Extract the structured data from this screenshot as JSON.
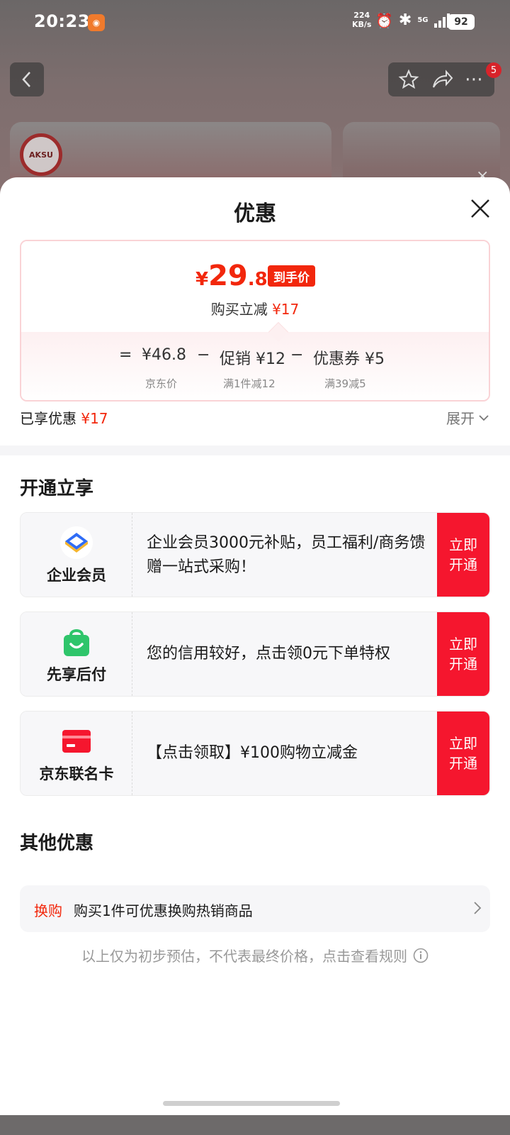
{
  "status_bar": {
    "time": "20:23",
    "speed_value": "224",
    "speed_unit": "KB/s",
    "network": "5G",
    "battery": "92"
  },
  "background": {
    "cart_badge": "5",
    "logo_text": "AKSU"
  },
  "sheet": {
    "title": "优惠",
    "price_card": {
      "final_price_yen": "¥",
      "final_price_int": "29",
      "final_price_dec": ".8",
      "final_price_tag": "到手价",
      "savings_label": "购买立减",
      "savings_amount": "¥17",
      "calc": {
        "eq": "=",
        "base_price": "¥46.8",
        "minus1": "−",
        "promo": "促销 ¥12",
        "minus2": "−",
        "coupon": "优惠券 ¥5",
        "base_label": "京东价",
        "promo_label": "满1件减12",
        "coupon_label": "满39减5"
      }
    },
    "enjoyed_label": "已享优惠",
    "enjoyed_amount": "¥17",
    "expand_label": "展开",
    "open_section_title": "开通立享",
    "open_cards": [
      {
        "icon": "enterprise-member-icon",
        "name": "企业会员",
        "desc": "企业会员3000元补贴，员工福利/商务馈赠一站式采购！",
        "button": "立即开通"
      },
      {
        "icon": "pay-later-bag-icon",
        "name": "先享后付",
        "desc": "您的信用较好，点击领0元下单特权",
        "button": "立即开通"
      },
      {
        "icon": "co-branded-card-icon",
        "name": "京东联名卡",
        "desc": "【点击领取】¥100购物立减金",
        "button": "立即开通"
      }
    ],
    "other_section_title": "其他优惠",
    "other_row": {
      "tag": "换购",
      "text": "购买1件可优惠换购热销商品"
    },
    "footnote": "以上仅为初步预估，不代表最终价格，点击查看规则"
  },
  "colors": {
    "accent_red": "#f2270c",
    "button_red": "#f5162e",
    "pay_later_green": "#2fc56b",
    "enterprise_blue": "#2f6cf6",
    "enterprise_gold": "#f5b52e"
  }
}
